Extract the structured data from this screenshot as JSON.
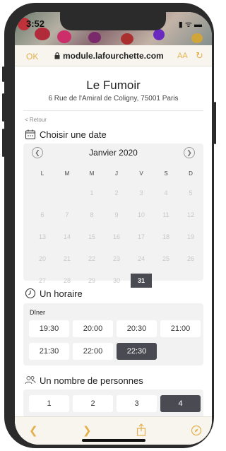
{
  "status": {
    "time": "3:52",
    "icons": "▮ ᯤ ▬"
  },
  "browser": {
    "ok_label": "OK",
    "url": "module.lafourchette.com",
    "text_size": "AA",
    "reload_icon": "reload-icon",
    "accent": "#e3b04b"
  },
  "restaurant": {
    "name": "Le Fumoir",
    "address": "6 Rue de l'Amiral de Coligny, 75001 Paris"
  },
  "nav": {
    "back_label": "< Retour"
  },
  "date_section": {
    "title": "Choisir une date",
    "month": "Janvier 2020",
    "weekdays": [
      "L",
      "M",
      "M",
      "J",
      "V",
      "S",
      "D"
    ],
    "weeks": [
      [
        "",
        "",
        "1",
        "2",
        "3",
        "4",
        "5"
      ],
      [
        "6",
        "7",
        "8",
        "9",
        "10",
        "11",
        "12"
      ],
      [
        "13",
        "14",
        "15",
        "16",
        "17",
        "18",
        "19"
      ],
      [
        "20",
        "21",
        "22",
        "23",
        "24",
        "25",
        "26"
      ],
      [
        "27",
        "28",
        "29",
        "30",
        "31",
        "",
        ""
      ]
    ],
    "selected_day": "31"
  },
  "time_section": {
    "title": "Un horaire",
    "service": "Dîner",
    "slots": [
      "19:30",
      "20:00",
      "20:30",
      "21:00",
      "21:30",
      "22:00",
      "22:30"
    ],
    "selected_slot": "22:30"
  },
  "people_section": {
    "title": "Un nombre de personnes",
    "options": [
      "1",
      "2",
      "3",
      "4"
    ],
    "selected": "4"
  },
  "colors": {
    "selected_bg": "#4a4a52",
    "panel_bg": "#f2f2f2"
  }
}
